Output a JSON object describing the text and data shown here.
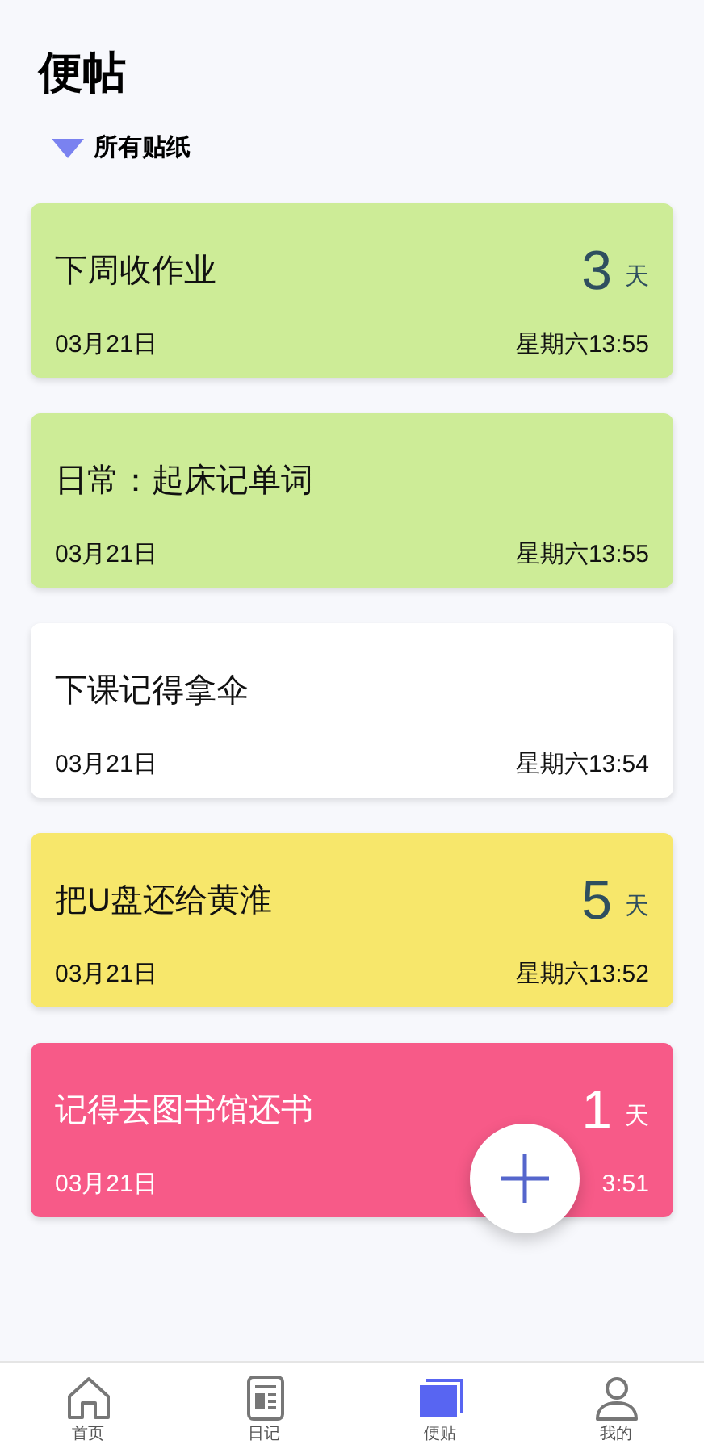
{
  "title": "便帖",
  "filter": {
    "label": "所有贴纸",
    "expanded": true
  },
  "notes": [
    {
      "title": "下周收作业",
      "days": "3",
      "unit": "天",
      "date": "03月21日",
      "time": "星期六13:55",
      "color": "#cdec97"
    },
    {
      "title": "日常：起床记单词",
      "date": "03月21日",
      "time": "星期六13:55",
      "color": "#cdec97"
    },
    {
      "title": "下课记得拿伞",
      "date": "03月21日",
      "time": "星期六13:54",
      "color": "#ffffff"
    },
    {
      "title": "把U盘还给黄淮",
      "days": "5",
      "unit": "天",
      "date": "03月21日",
      "time": "星期六13:52",
      "color": "#f7e76b"
    },
    {
      "title": "记得去图书馆还书",
      "days": "1",
      "unit": "天",
      "date": "03月21日",
      "time": "3:51",
      "color": "#f75a88"
    }
  ],
  "tabs": [
    {
      "label": "首页",
      "kind": "home",
      "selected": false
    },
    {
      "label": "日记",
      "kind": "diary",
      "selected": false
    },
    {
      "label": "便贴",
      "kind": "notes",
      "selected": true
    },
    {
      "label": "我的",
      "kind": "profile",
      "selected": false
    }
  ]
}
